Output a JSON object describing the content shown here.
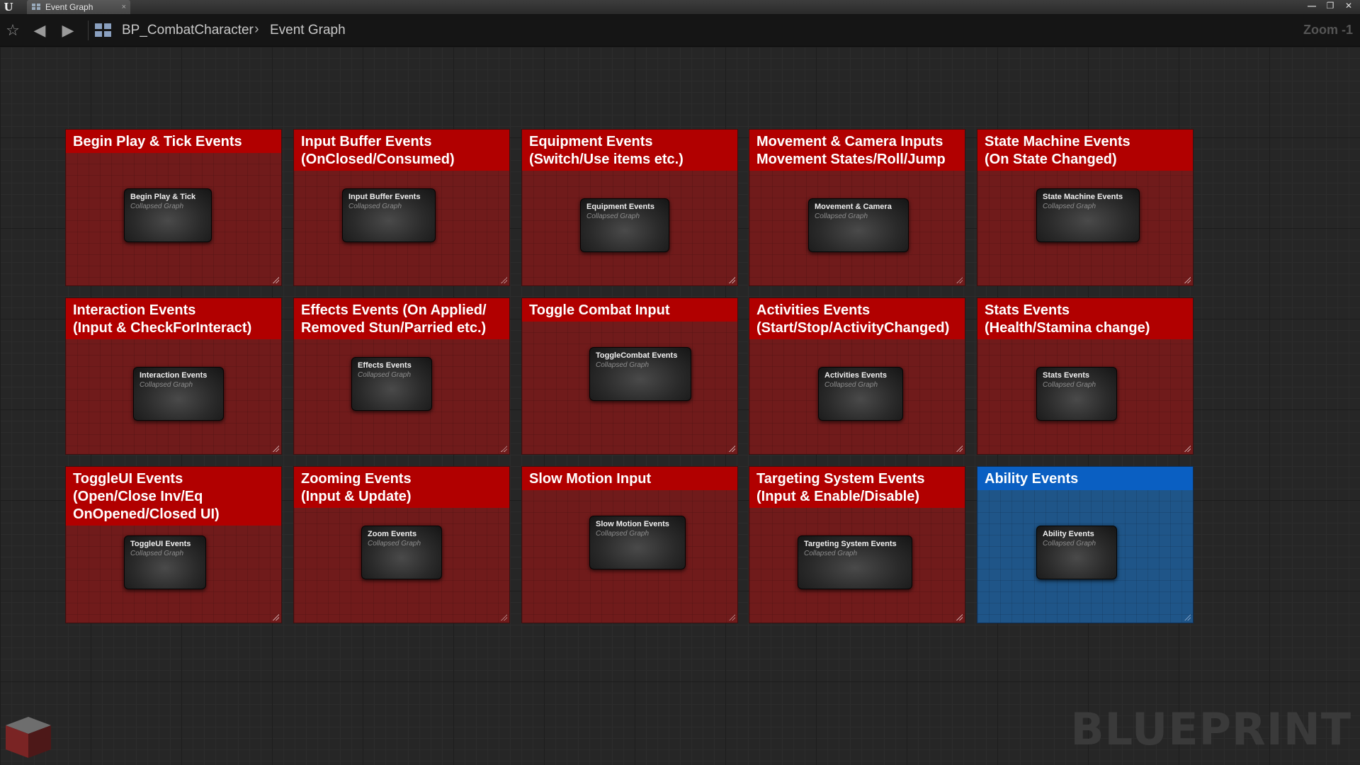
{
  "window": {
    "tab_label": "Event Graph",
    "tab_close": "×",
    "buttons": {
      "minimize": "—",
      "restore": "❐",
      "close": "✕"
    }
  },
  "toolbar": {
    "breadcrumb": [
      "BP_CombatCharacter",
      "Event Graph"
    ],
    "breadcrumb_separator": "›",
    "zoom": "Zoom -1"
  },
  "colors": {
    "comment_header_red": "#b10000",
    "comment_body_red": "#701b1b",
    "comment_header_blue": "#0a5fc2",
    "comment_body_blue": "#1f5588"
  },
  "comments": [
    {
      "title": "Begin Play & Tick Events",
      "node_title": "Begin Play & Tick",
      "node_sub": "Collapsed Graph",
      "color": "red"
    },
    {
      "title": "Input Buffer Events\n(OnClosed/Consumed)",
      "node_title": "Input Buffer Events",
      "node_sub": "Collapsed Graph",
      "color": "red"
    },
    {
      "title": "Equipment Events\n(Switch/Use items etc.)",
      "node_title": "Equipment Events",
      "node_sub": "Collapsed Graph",
      "color": "red"
    },
    {
      "title": "Movement & Camera Inputs\nMovement States/Roll/Jump",
      "node_title": "Movement & Camera",
      "node_sub": "Collapsed Graph",
      "color": "red"
    },
    {
      "title": "State Machine Events\n(On State Changed)",
      "node_title": "State Machine Events",
      "node_sub": "Collapsed Graph",
      "color": "red"
    },
    {
      "title": "Interaction Events\n(Input & CheckForInteract)",
      "node_title": "Interaction Events",
      "node_sub": "Collapsed Graph",
      "color": "red"
    },
    {
      "title": "Effects Events (On Applied/\nRemoved Stun/Parried etc.)",
      "node_title": "Effects Events",
      "node_sub": "Collapsed Graph",
      "color": "red"
    },
    {
      "title": "Toggle Combat Input",
      "node_title": "ToggleCombat Events",
      "node_sub": "Collapsed Graph",
      "color": "red"
    },
    {
      "title": "Activities Events\n(Start/Stop/ActivityChanged)",
      "node_title": "Activities Events",
      "node_sub": "Collapsed Graph",
      "color": "red"
    },
    {
      "title": "Stats Events\n(Health/Stamina change)",
      "node_title": "Stats Events",
      "node_sub": "Collapsed Graph",
      "color": "red"
    },
    {
      "title": "ToggleUI Events\n(Open/Close Inv/Eq\nOnOpened/Closed UI)",
      "node_title": "ToggleUI Events",
      "node_sub": "Collapsed Graph",
      "color": "red"
    },
    {
      "title": "Zooming Events\n(Input & Update)",
      "node_title": "Zoom Events",
      "node_sub": "Collapsed Graph",
      "color": "red"
    },
    {
      "title": "Slow Motion Input",
      "node_title": "Slow Motion Events",
      "node_sub": "Collapsed Graph",
      "color": "red"
    },
    {
      "title": "Targeting System Events\n(Input & Enable/Disable)",
      "node_title": "Targeting System Events",
      "node_sub": "Collapsed Graph",
      "color": "red"
    },
    {
      "title": "Ability Events",
      "node_title": "Ability Events",
      "node_sub": "Collapsed Graph",
      "color": "blue"
    }
  ],
  "watermark": "BLUEPRINT"
}
